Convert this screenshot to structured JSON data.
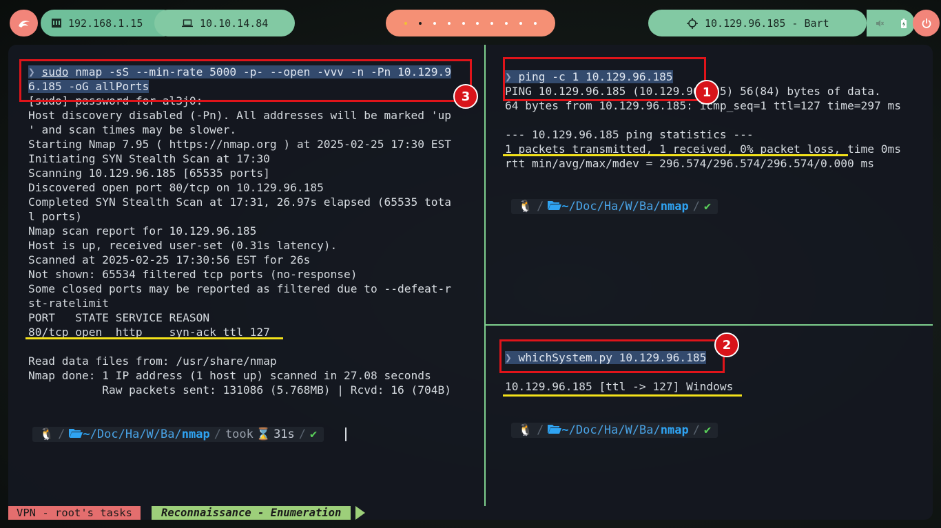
{
  "topbar": {
    "local_ip": "192.168.1.15",
    "vpn_ip": "10.10.14.84",
    "target": "10.129.96.185 - Bart",
    "workspace_count": 10,
    "active_workspace": 2
  },
  "left_pane": {
    "lines": [
      "[sudo] password for al3j0:",
      "Host discovery disabled (-Pn). All addresses will be marked 'up",
      "' and scan times may be slower.",
      "Starting Nmap 7.95 ( https://nmap.org ) at 2025-02-25 17:30 EST",
      "Initiating SYN Stealth Scan at 17:30",
      "Scanning 10.129.96.185 [65535 ports]",
      "Discovered open port 80/tcp on 10.129.96.185",
      "Completed SYN Stealth Scan at 17:31, 26.97s elapsed (65535 tota",
      "l ports)",
      "Nmap scan report for 10.129.96.185",
      "Host is up, received user-set (0.31s latency).",
      "Scanned at 2025-02-25 17:30:56 EST for 26s",
      "Not shown: 65534 filtered tcp ports (no-response)",
      "Some closed ports may be reported as filtered due to --defeat-r",
      "st-ratelimit",
      "PORT   STATE SERVICE REASON",
      "80/tcp open  http    syn-ack ttl 127",
      "",
      "Read data files from: /usr/share/nmap",
      "Nmap done: 1 IP address (1 host up) scanned in 27.08 seconds",
      "           Raw packets sent: 131086 (5.768MB) | Rcvd: 16 (704B)"
    ],
    "cmd_arrow": "❯",
    "cmd_sudo": "sudo",
    "cmd_line1": " nmap -sS --min-rate 5000 -p- --open -vvv -n -Pn 10.129.9",
    "cmd_line2": "6.185 -oG allPorts",
    "prompt": {
      "tilde": "~",
      "path": "/Doc/Ha/W/Ba/",
      "cwd": "nmap",
      "took_label": "took",
      "took_value": "31s",
      "ok": "✔"
    }
  },
  "right_top": {
    "cmd": "ping -c 1 10.129.96.185",
    "lines": [
      "PING 10.129.96.185 (10.129.96.185) 56(84) bytes of data.",
      "64 bytes from 10.129.96.185: icmp_seq=1 ttl=127 time=297 ms",
      "",
      "--- 10.129.96.185 ping statistics ---",
      "1 packets transmitted, 1 received, 0% packet loss, time 0ms",
      "rtt min/avg/max/mdev = 296.574/296.574/296.574/0.000 ms"
    ],
    "prompt": {
      "tilde": "~",
      "path": "/Doc/Ha/W/Ba/",
      "cwd": "nmap",
      "ok": "✔"
    }
  },
  "right_bottom": {
    "cmd": "whichSystem.py 10.129.96.185",
    "result": "10.129.96.185 [ttl -> 127] Windows",
    "prompt": {
      "tilde": "~",
      "path": "/Doc/Ha/W/Ba/",
      "cwd": "nmap",
      "ok": "✔"
    }
  },
  "annotations": {
    "badge1": "1",
    "badge2": "2",
    "badge3": "3"
  },
  "statusbar": {
    "session": "VPN - root's tasks",
    "window": "Reconnaissance - Enumeration"
  },
  "colors": {
    "red_box": "#e0141a",
    "underline": "#f4e21a",
    "pane_divider": "#7fd18f",
    "selection": "#334a6d"
  }
}
